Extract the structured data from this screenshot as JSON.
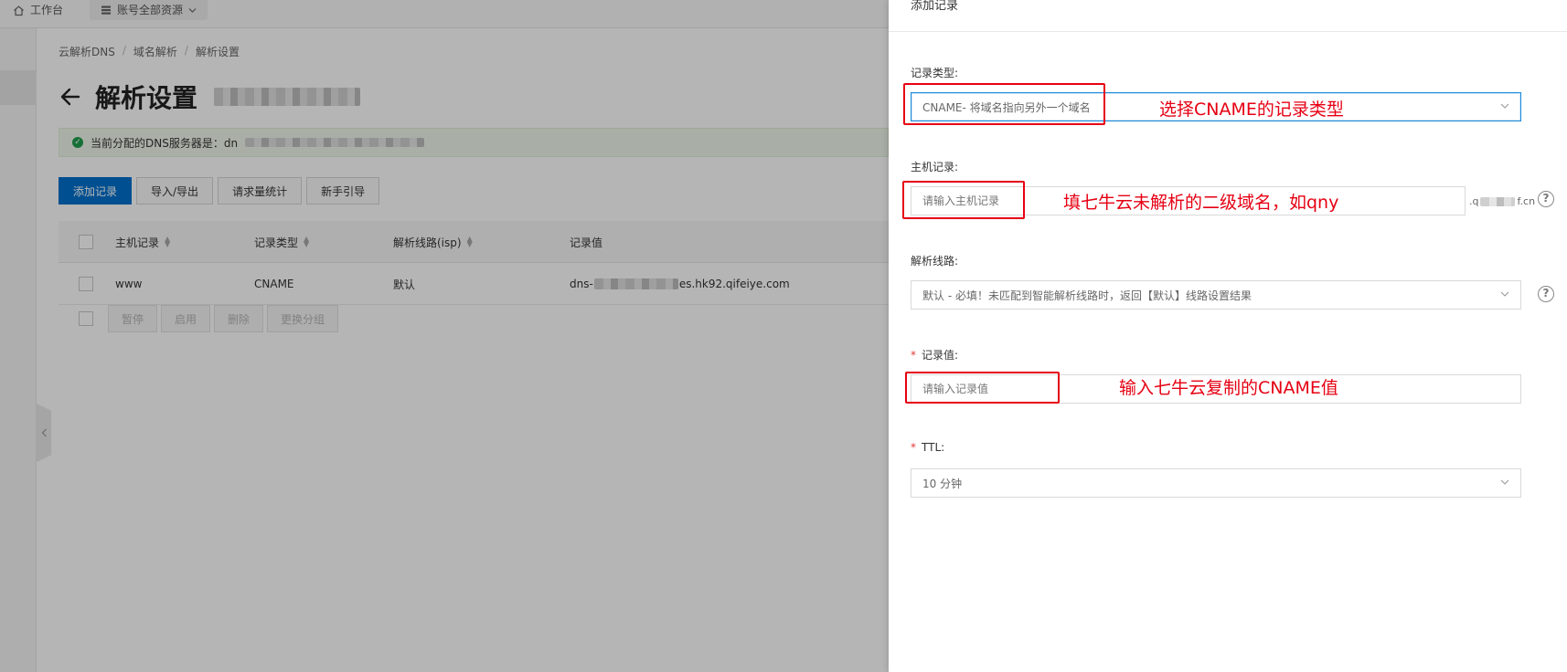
{
  "topbar": {
    "workspace_label": "工作台",
    "resources_label": "账号全部资源"
  },
  "breadcrumb": [
    "云解析DNS",
    "域名解析",
    "解析设置"
  ],
  "page": {
    "title": "解析设置",
    "notice_text": "当前分配的DNS服务器是：dn"
  },
  "actions": {
    "add_record": "添加记录",
    "import_export": "导入/导出",
    "request_stats": "请求量统计",
    "guide": "新手引导"
  },
  "table": {
    "columns": [
      "主机记录",
      "记录类型",
      "解析线路(isp)",
      "记录值"
    ],
    "rows": [
      {
        "host": "www",
        "type": "CNAME",
        "line": "默认",
        "value_prefix": "dns-",
        "value_suffix": "es.hk92.qifeiye.com"
      }
    ],
    "bulk_actions": [
      "暂停",
      "启用",
      "删除",
      "更换分组"
    ]
  },
  "drawer": {
    "title": "添加记录",
    "fields": {
      "record_type": {
        "label": "记录类型:",
        "value": "CNAME- 将域名指向另外一个域名"
      },
      "host": {
        "label": "主机记录:",
        "placeholder": "请输入主机记录",
        "suffix_start": ".q",
        "suffix_end": "f.cn"
      },
      "line": {
        "label": "解析线路:",
        "value": "默认 - 必填！未匹配到智能解析线路时，返回【默认】线路设置结果"
      },
      "value": {
        "required_mark": "*",
        "label": "记录值:",
        "placeholder": "请输入记录值"
      },
      "ttl": {
        "required_mark": "*",
        "label": "TTL:",
        "value": "10 分钟"
      }
    },
    "help_glyph": "?"
  },
  "annotations": {
    "record_type_note": "选择CNAME的记录类型",
    "host_note": "填七牛云未解析的二级域名，如qny",
    "value_note": "输入七牛云复制的CNAME值"
  },
  "colors": {
    "primary": "#0070cc",
    "annotation": "#e60012",
    "focus_border": "#1b89d8",
    "success": "#1e9e4e"
  }
}
